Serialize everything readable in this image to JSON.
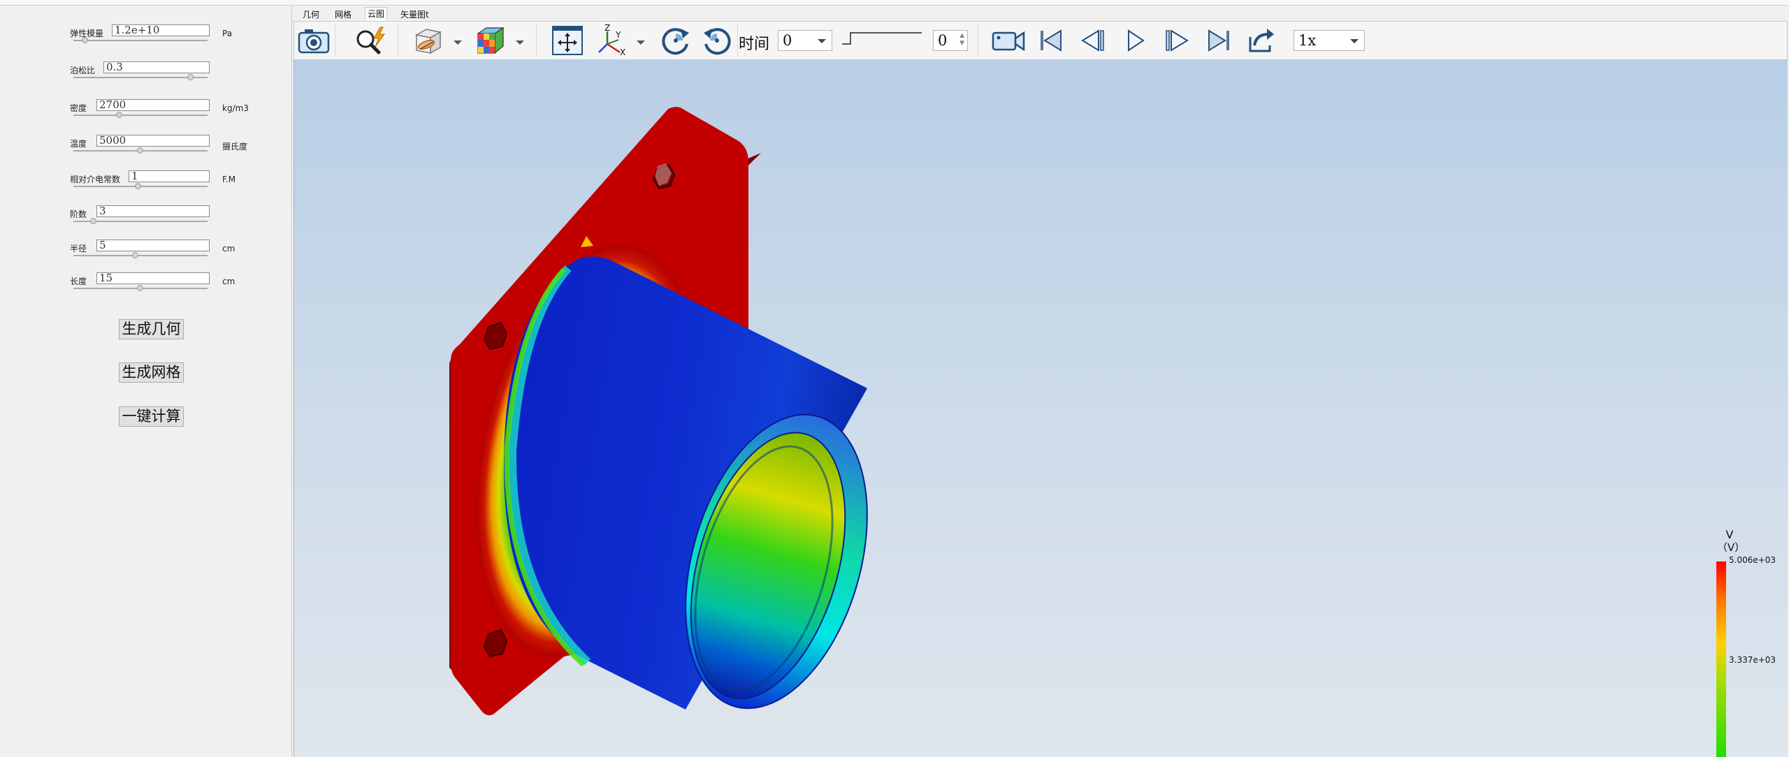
{
  "params": [
    {
      "label": "弹性模量",
      "value": "1.2e+10",
      "unit": "Pa",
      "thumb": 0.06
    },
    {
      "label": "泊松比",
      "value": "0.3",
      "unit": "",
      "thumb": 0.88
    },
    {
      "label": "密度",
      "value": "2700",
      "unit": "kg/m3",
      "thumb": 0.22
    },
    {
      "label": "温度",
      "value": "5000",
      "unit": "摄氏度",
      "thumb": 0.5
    },
    {
      "label": "相对介电常数",
      "value": "1",
      "unit": "F.M",
      "thumb": 0.48
    },
    {
      "label": "阶数",
      "value": "3",
      "unit": "",
      "thumb": 0.13
    },
    {
      "label": "半径",
      "value": "5",
      "unit": "cm",
      "thumb": 0.46
    },
    {
      "label": "长度",
      "value": "15",
      "unit": "cm",
      "thumb": 0.5
    }
  ],
  "buttons": {
    "generate_geometry": "生成几何",
    "generate_mesh": "生成网格",
    "one_click_compute": "一键计算"
  },
  "tabs": [
    "几何",
    "网格",
    "云图",
    "矢量图t"
  ],
  "active_tab": "云图",
  "toolbar": {
    "time_label": "时间",
    "time_value": "0",
    "frame_value": "0",
    "speed_value": "1x"
  },
  "legend": {
    "title": "V",
    "unit": "（V）",
    "max": "5.006e+03",
    "mid": "3.337e+03"
  },
  "colors": {
    "high": "#d40000",
    "low": "#0a1fcf",
    "background_top": "#b9cfe6"
  }
}
